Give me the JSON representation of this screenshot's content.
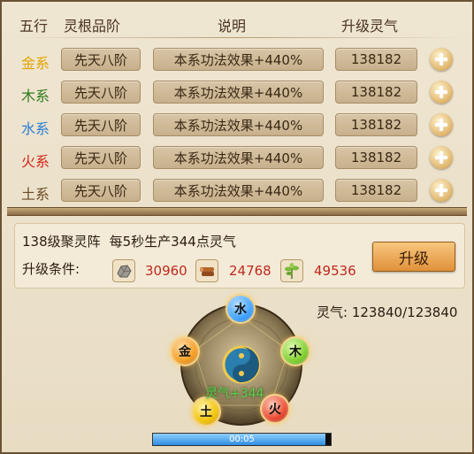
{
  "header": {
    "col_element": "五行",
    "col_grade": "灵根品阶",
    "col_desc": "说明",
    "col_cost": "升级灵气"
  },
  "rows": [
    {
      "element": "金系",
      "grade": "先天八阶",
      "desc": "本系功法效果+440%",
      "cost": "138182",
      "color": "#e0a300"
    },
    {
      "element": "木系",
      "grade": "先天八阶",
      "desc": "本系功法效果+440%",
      "cost": "138182",
      "color": "#2f7a1e"
    },
    {
      "element": "水系",
      "grade": "先天八阶",
      "desc": "本系功法效果+440%",
      "cost": "138182",
      "color": "#2a7fd4"
    },
    {
      "element": "火系",
      "grade": "先天八阶",
      "desc": "本系功法效果+440%",
      "cost": "138182",
      "color": "#d4261a"
    },
    {
      "element": "土系",
      "grade": "先天八阶",
      "desc": "本系功法效果+440%",
      "cost": "138182",
      "color": "#6b4a24"
    }
  ],
  "array": {
    "level_name": "138级聚灵阵",
    "production": "每5秒生产344点灵气",
    "condition_label": "升级条件:",
    "upgrade_label": "升级",
    "resources": [
      {
        "icon": "ore-icon",
        "value": "30960"
      },
      {
        "icon": "wood-icon",
        "value": "24768"
      },
      {
        "icon": "herb-icon",
        "value": "49536"
      }
    ]
  },
  "qi": {
    "label": "灵气:",
    "value": "123840/123840",
    "gain": "灵气+344"
  },
  "wheel": {
    "elements": [
      {
        "char": "水",
        "color": "#3aa0ff"
      },
      {
        "char": "木",
        "color": "#7ccc2a"
      },
      {
        "char": "火",
        "color": "#e8452a"
      },
      {
        "char": "土",
        "color": "#f2c100"
      },
      {
        "char": "金",
        "color": "#f39a1c"
      }
    ]
  },
  "timer": {
    "text": "00:05",
    "progress": 0.97
  }
}
